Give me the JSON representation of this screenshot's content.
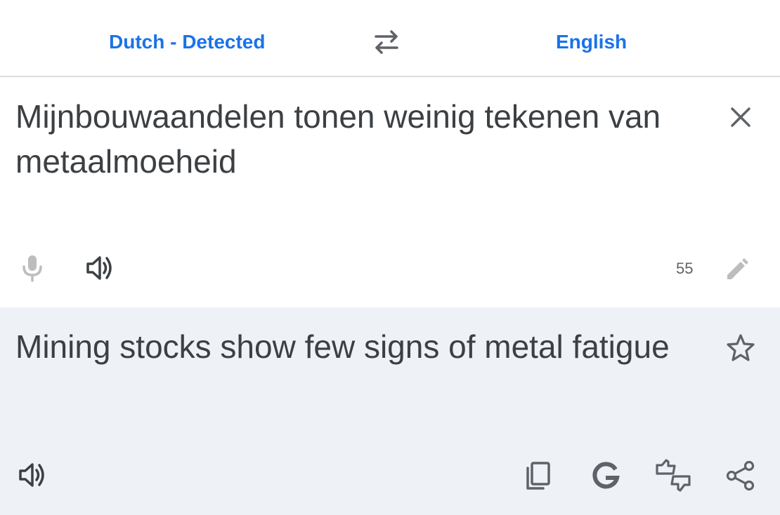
{
  "header": {
    "source_language": "Dutch - Detected",
    "target_language": "English",
    "swap_icon": "swap-arrows-icon"
  },
  "source": {
    "text": "Mijnbouwaandelen tonen weinig tekenen van metaalmoeheid",
    "char_count": "55",
    "icons": [
      "close-icon",
      "microphone-icon",
      "speaker-icon",
      "pencil-icon"
    ]
  },
  "translation": {
    "text": "Mining stocks show few signs of metal fatigue",
    "icons": [
      "star-icon",
      "speaker-icon",
      "copy-icon",
      "google-icon",
      "feedback-icon",
      "share-icon"
    ]
  },
  "colors": {
    "accent": "#1a73e8",
    "text": "#3c4043",
    "icon": "#5f6368",
    "disabled_icon": "#bdbdbd",
    "translation_bg": "#eef2f7"
  }
}
